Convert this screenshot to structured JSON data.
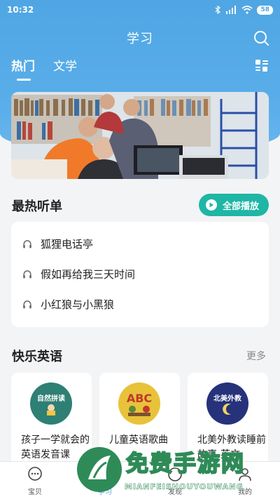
{
  "status_bar": {
    "time": "10:32",
    "battery": "58"
  },
  "header": {
    "title": "学习"
  },
  "tabs": [
    {
      "label": "热门",
      "active": true
    },
    {
      "label": "文学",
      "active": false
    }
  ],
  "hot_list": {
    "title": "最热听单",
    "play_all_label": "全部播放",
    "items": [
      {
        "label": "狐狸电话亭"
      },
      {
        "label": "假如再给我三天时间"
      },
      {
        "label": "小红狼与小黑狼"
      }
    ]
  },
  "english": {
    "title": "快乐英语",
    "more_label": "更多",
    "cards": [
      {
        "label": "孩子一学就会的英语发音课",
        "cover_text": "自然拼读",
        "cover_color": "#2e7f74"
      },
      {
        "label": "儿童英语歌曲",
        "cover_text": "ABC",
        "cover_color": "#e8c23a"
      },
      {
        "label": "北美外教读睡前故事-英文",
        "cover_text": "北美外教",
        "cover_color": "#26327a"
      }
    ]
  },
  "bottom_nav": [
    {
      "label": "宝贝",
      "icon": "chat-bubble-icon",
      "active": false
    },
    {
      "label": "学习",
      "icon": "book-icon",
      "active": true
    },
    {
      "label": "发现",
      "icon": "compass-icon",
      "active": false
    },
    {
      "label": "我的",
      "icon": "person-icon",
      "active": false
    }
  ],
  "watermark": {
    "title": "免费手游网",
    "subtitle": "MIANFEISHOUYOUWANG"
  },
  "colors": {
    "primary": "#4fa6e3",
    "accent": "#1fb6a6"
  }
}
